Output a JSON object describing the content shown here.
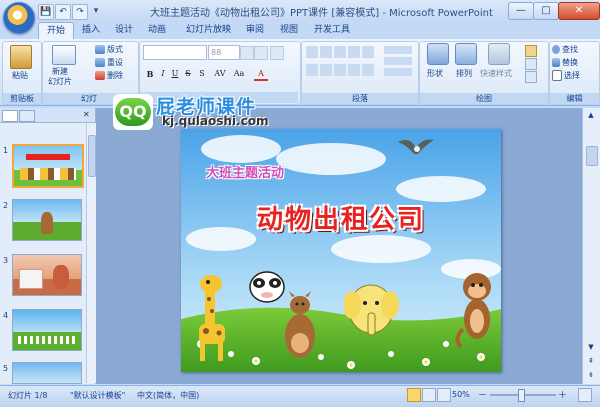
{
  "window": {
    "title": "大班主题活动《动物出租公司》PPT课件 [兼容模式] - Microsoft PowerPoint",
    "minimize": "—",
    "maximize": "□",
    "close": "✕"
  },
  "qat": {
    "save": "💾",
    "undo": "↶",
    "redo": "↷",
    "more": "▾"
  },
  "tabs": [
    "开始",
    "插入",
    "设计",
    "动画",
    "幻灯片放映",
    "审阅",
    "视图",
    "开发工具"
  ],
  "ribbon": {
    "clipboard": {
      "paste": "粘贴",
      "label": "剪贴板"
    },
    "slides": {
      "new_slide": "新建",
      "new_slide2": "幻灯片",
      "layout": "版式",
      "reset": "重设",
      "delete": "删除",
      "label": "幻灯"
    },
    "font": {
      "size": "88",
      "label": "字体"
    },
    "paragraph": {
      "label": "段落"
    },
    "drawing": {
      "shape": "形状",
      "arrange": "排列",
      "quick_styles": "快速样式",
      "label": "绘图"
    },
    "editing": {
      "find": "查找",
      "replace": "替换",
      "select": "选择",
      "label": "编辑"
    }
  },
  "watermark": {
    "brand": "QQ",
    "name": "屁老师课件",
    "url": "kj.qulaoshi.com"
  },
  "slide_panel": {
    "numbers": [
      "1",
      "2",
      "3",
      "4",
      "5"
    ]
  },
  "slide": {
    "subtitle": "大班主题活动",
    "title": "动物出租公司"
  },
  "statusbar": {
    "slide_info": "幻灯片 1/8",
    "theme": "\"默认设计模板\"",
    "language": "中文(简体，中国)",
    "zoom": "50%",
    "zoom_minus": "－",
    "zoom_plus": "＋"
  },
  "colors": {
    "ribbon": "#dbe8f8",
    "accent": "#15428b",
    "slide_title": "#e8231f",
    "selected_thumb": "#f3a63a"
  }
}
